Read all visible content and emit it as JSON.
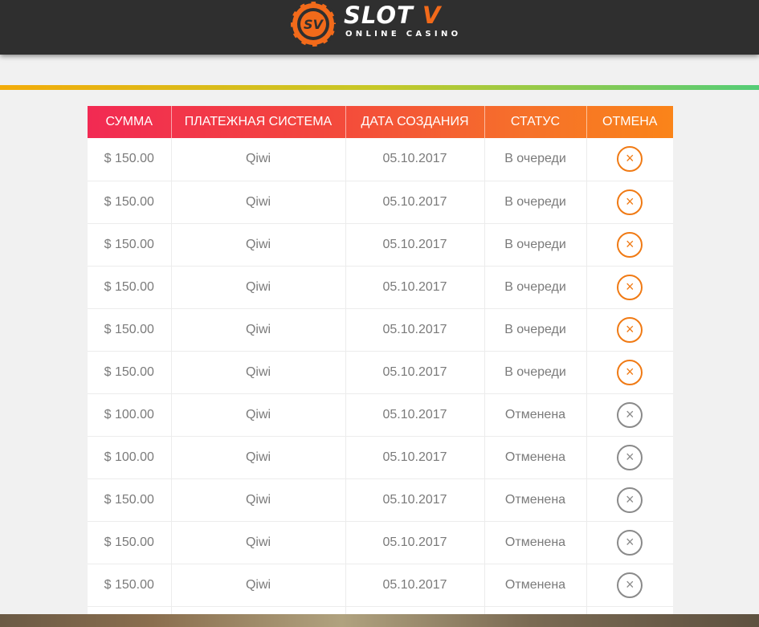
{
  "header": {
    "logo": {
      "badge": "SV",
      "word": "SLOT",
      "word_accent": "V",
      "subtitle": "ONLINE CASINO"
    }
  },
  "colors": {
    "header_bg": "#2f2f2f",
    "accent_orange": "#f07a14",
    "table_head_start": "#f22a53",
    "table_head_end": "#fa8419",
    "cancelled_gray": "#8a8a8a"
  },
  "table": {
    "columns": [
      "СУММА",
      "ПЛАТЕЖНАЯ СИСТЕМА",
      "ДАТА СОЗДАНИЯ",
      "СТАТУС",
      "ОТМЕНА"
    ],
    "rows": [
      {
        "amount": "$ 150.00",
        "system": "Qiwi",
        "date": "05.10.2017",
        "status": "В очереди",
        "cancelable": true
      },
      {
        "amount": "$ 150.00",
        "system": "Qiwi",
        "date": "05.10.2017",
        "status": "В очереди",
        "cancelable": true
      },
      {
        "amount": "$ 150.00",
        "system": "Qiwi",
        "date": "05.10.2017",
        "status": "В очереди",
        "cancelable": true
      },
      {
        "amount": "$ 150.00",
        "system": "Qiwi",
        "date": "05.10.2017",
        "status": "В очереди",
        "cancelable": true
      },
      {
        "amount": "$ 150.00",
        "system": "Qiwi",
        "date": "05.10.2017",
        "status": "В очереди",
        "cancelable": true
      },
      {
        "amount": "$ 150.00",
        "system": "Qiwi",
        "date": "05.10.2017",
        "status": "В очереди",
        "cancelable": true
      },
      {
        "amount": "$ 100.00",
        "system": "Qiwi",
        "date": "05.10.2017",
        "status": "Отменена",
        "cancelable": false
      },
      {
        "amount": "$ 100.00",
        "system": "Qiwi",
        "date": "05.10.2017",
        "status": "Отменена",
        "cancelable": false
      },
      {
        "amount": "$ 150.00",
        "system": "Qiwi",
        "date": "05.10.2017",
        "status": "Отменена",
        "cancelable": false
      },
      {
        "amount": "$ 150.00",
        "system": "Qiwi",
        "date": "05.10.2017",
        "status": "Отменена",
        "cancelable": false
      },
      {
        "amount": "$ 150.00",
        "system": "Qiwi",
        "date": "05.10.2017",
        "status": "Отменена",
        "cancelable": false
      },
      {
        "amount": "",
        "system": "",
        "date": "",
        "status": "",
        "cancelable": null
      }
    ],
    "cancel_icon": "close-icon",
    "cancel_glyph": "×"
  }
}
